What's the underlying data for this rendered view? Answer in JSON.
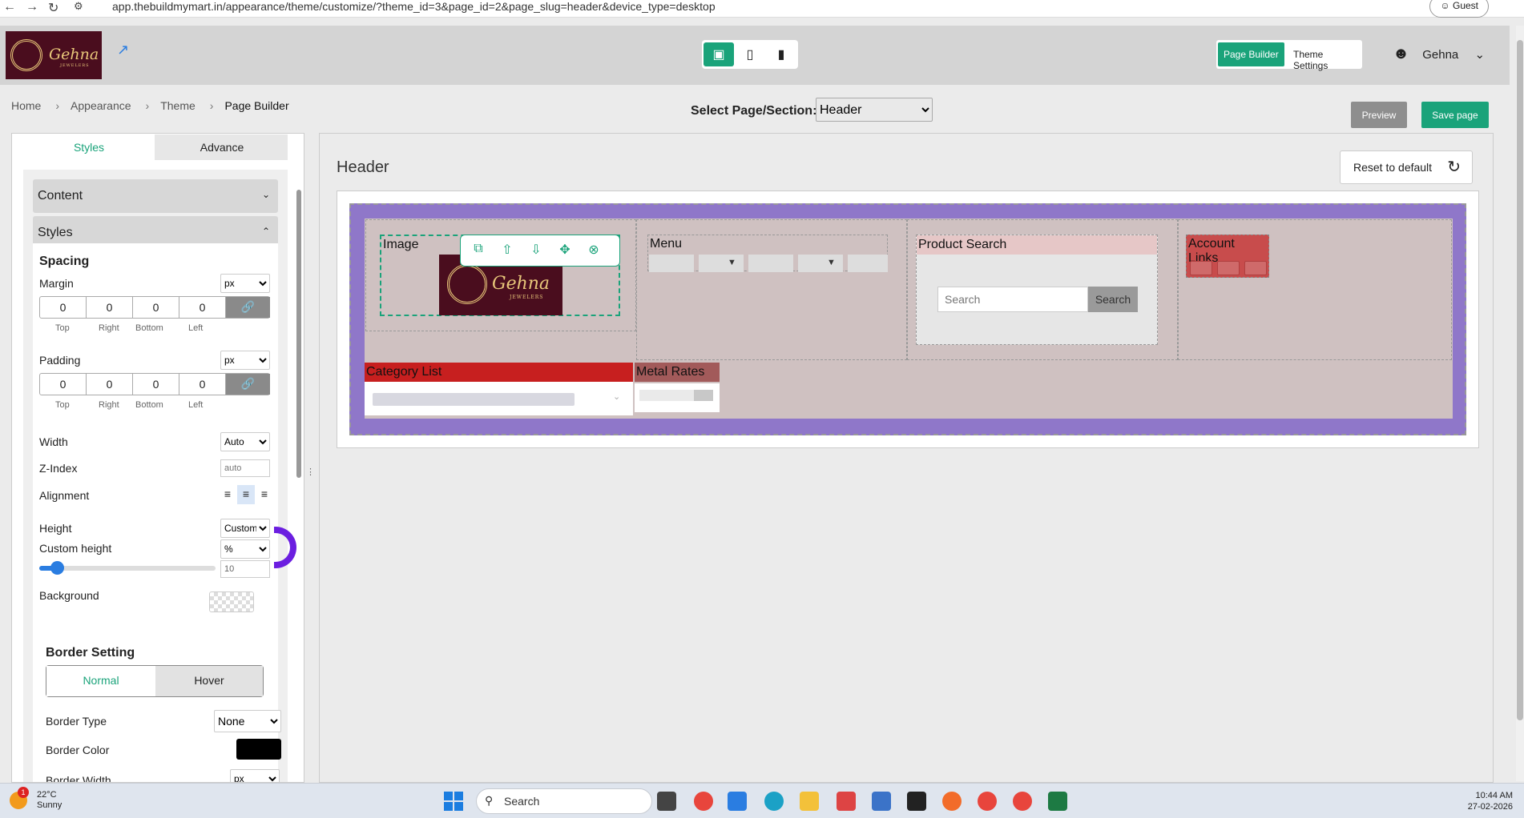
{
  "browser": {
    "url": "app.thebuildmymart.in/appearance/theme/customize/?theme_id=3&page_id=2&page_slug=header&device_type=desktop",
    "profile": "Guest"
  },
  "appbar": {
    "logo_text": "Gehna",
    "logo_sub": "JEWELERS",
    "tabs": [
      "Page Builder",
      "Theme Settings"
    ],
    "active_tab": "Page Builder",
    "user_name": "Gehna",
    "devices": [
      "desktop",
      "tablet",
      "mobile"
    ],
    "active_device": "desktop"
  },
  "breadcrumb": [
    "Home",
    "Appearance",
    "Theme",
    "Page Builder"
  ],
  "select_page": {
    "label": "Select Page/Section:",
    "value": "Header"
  },
  "actions": {
    "preview": "Preview",
    "save": "Save page"
  },
  "sidebar": {
    "tabs": [
      "Styles",
      "Advance"
    ],
    "active_tab": "Styles",
    "sections": {
      "content": "Content",
      "styles": "Styles"
    },
    "spacing": {
      "title": "Spacing",
      "margin": {
        "label": "Margin",
        "unit": "px",
        "values": [
          "0",
          "0",
          "0",
          "0"
        ]
      },
      "padding": {
        "label": "Padding",
        "unit": "px",
        "values": [
          "0",
          "0",
          "0",
          "0"
        ]
      },
      "sides": [
        "Top",
        "Right",
        "Bottom",
        "Left"
      ]
    },
    "width": {
      "label": "Width",
      "value": "Auto"
    },
    "zindex": {
      "label": "Z-Index",
      "placeholder": "auto"
    },
    "alignment": {
      "label": "Alignment",
      "active": "center"
    },
    "height": {
      "label": "Height",
      "value": "Custom"
    },
    "custom_height": {
      "label": "Custom height",
      "unit": "%",
      "value": "10",
      "slider_fraction": 0.1
    },
    "background": {
      "label": "Background"
    },
    "border": {
      "title": "Border Setting",
      "tabs": [
        "Normal",
        "Hover"
      ],
      "active_tab": "Normal",
      "type": {
        "label": "Border Type",
        "value": "None"
      },
      "color": {
        "label": "Border Color",
        "value": "#000000"
      },
      "width": {
        "label": "Border Width",
        "unit": "px"
      }
    }
  },
  "canvas": {
    "title": "Header",
    "reset": "Reset to default",
    "blocks": {
      "image": "Image",
      "menu": "Menu",
      "product_search": "Product Search",
      "account_links": "Account Links",
      "category_list": "Category List",
      "metal_rates": "Metal Rates"
    },
    "search": {
      "placeholder": "Search",
      "button": "Search"
    },
    "logo_text": "Gehna",
    "logo_sub": "JEWELERS"
  },
  "taskbar": {
    "weather_temp": "22°C",
    "weather_desc": "Sunny",
    "weather_badge": "1",
    "search_placeholder": "Search",
    "time": "10:44 AM",
    "date": "27-02-2026"
  },
  "colors": {
    "accent": "#1aa37a",
    "stage": "#8f77c9",
    "category_bar": "#c71f1f",
    "metal_bar": "#a25a5a",
    "account_links": "#c84c4c"
  }
}
